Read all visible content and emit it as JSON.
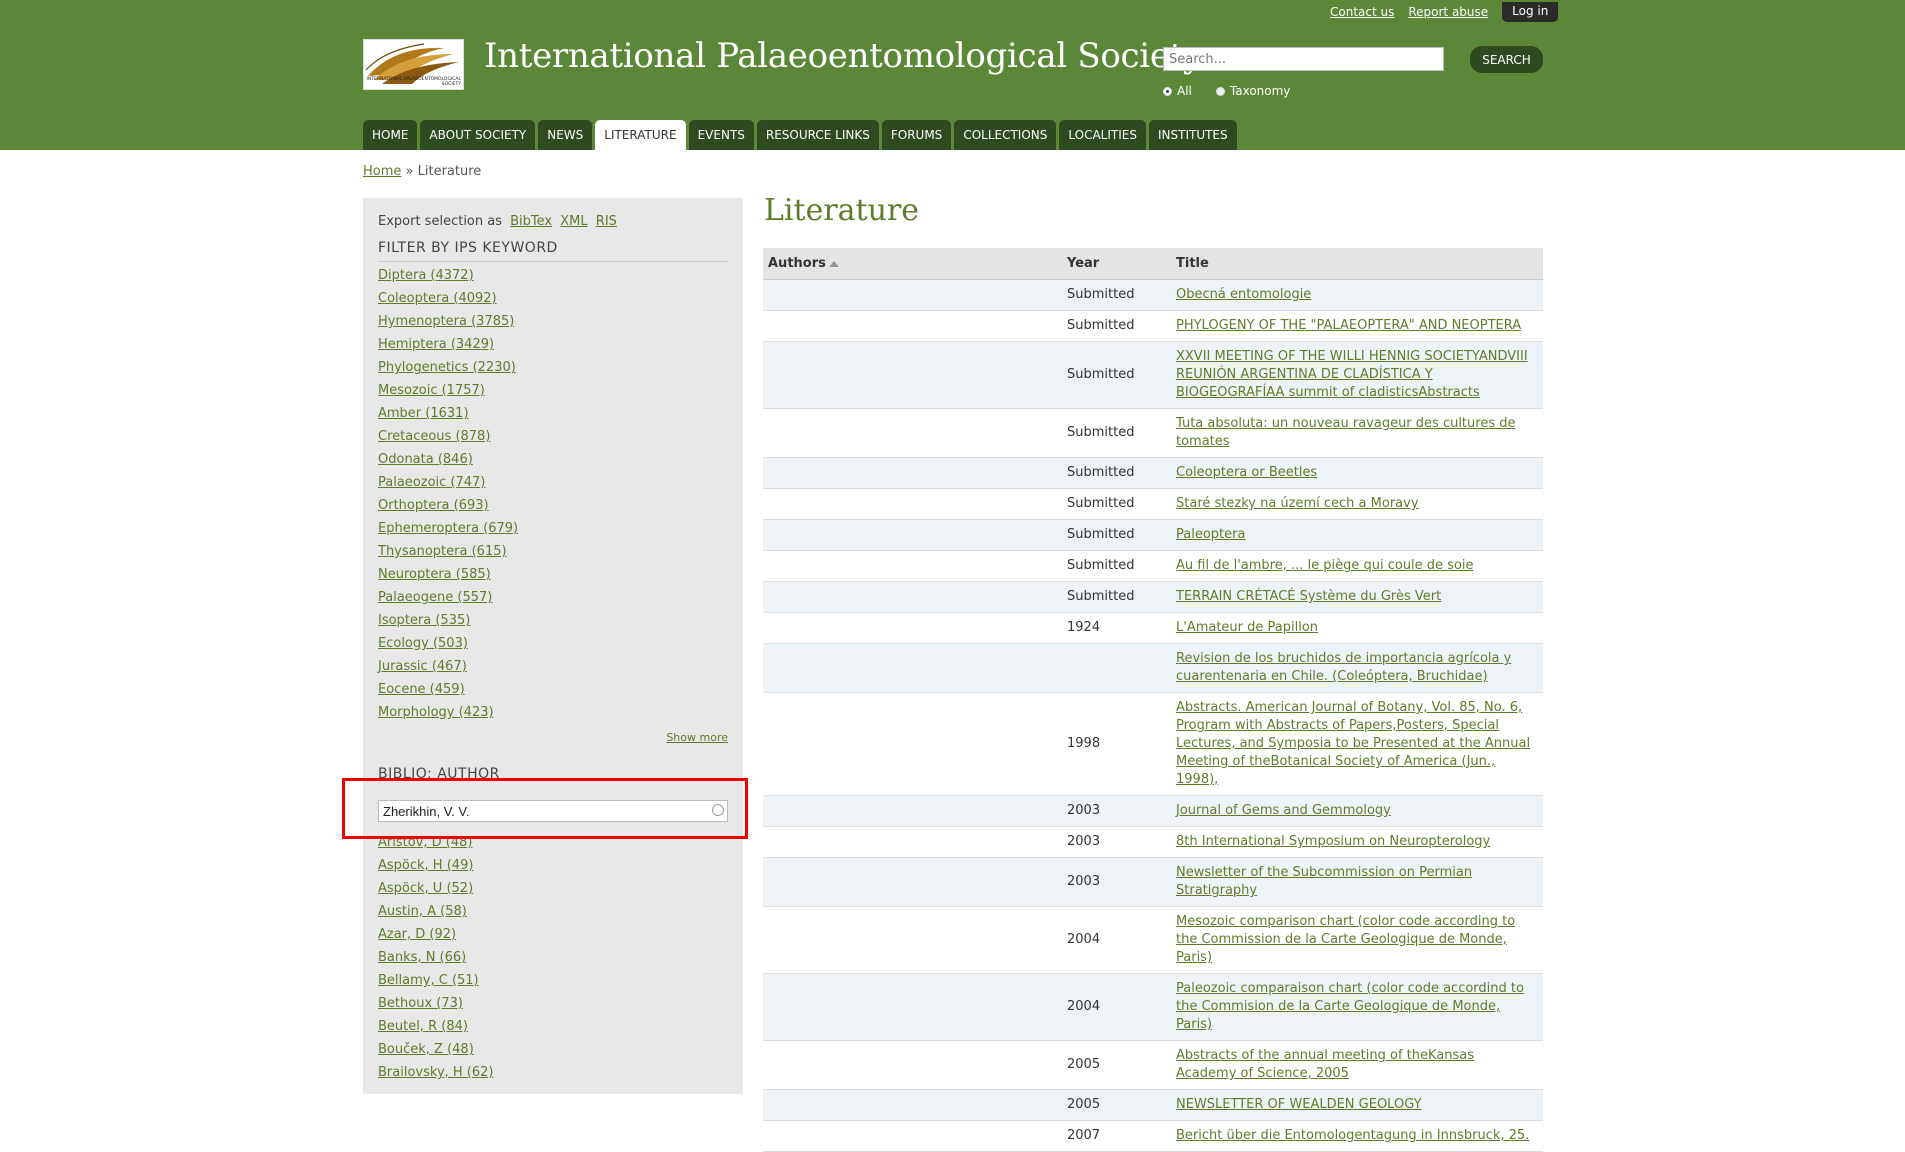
{
  "header": {
    "contact_label": "Contact us",
    "report_label": "Report abuse",
    "login_label": "Log in",
    "site_title": "International Palaeoentomological Society",
    "logo_text": "INTERNATIONAL PALAEOENTOMOLOGICAL SOCIETY",
    "search_placeholder": "Search...",
    "search_button": "Search",
    "radio_all": "All",
    "radio_taxonomy": "Taxonomy",
    "nav": [
      "HOME",
      "ABOUT SOCIETY",
      "NEWS",
      "LITERATURE",
      "EVENTS",
      "RESOURCE LINKS",
      "FORUMS",
      "COLLECTIONS",
      "LOCALITIES",
      "INSTITUTES"
    ],
    "active_tab": "LITERATURE"
  },
  "breadcrumb": {
    "home": "Home",
    "sep": "»",
    "current": "Literature"
  },
  "sidebar": {
    "export_label": "Export selection as",
    "export_formats": [
      "BibTex",
      "XML",
      "RIS"
    ],
    "keyword_title": "FILTER BY IPS KEYWORD",
    "keywords": [
      "Diptera (4372)",
      "Coleoptera (4092)",
      "Hymenoptera (3785)",
      "Hemiptera (3429)",
      "Phylogenetics (2230)",
      "Mesozoic (1757)",
      "Amber (1631)",
      "Cretaceous (878)",
      "Odonata (846)",
      "Palaeozoic (747)",
      "Orthoptera (693)",
      "Ephemeroptera (679)",
      "Thysanoptera (615)",
      "Neuroptera (585)",
      "Palaeogene (557)",
      "Isoptera (535)",
      "Ecology (503)",
      "Jurassic (467)",
      "Eocene (459)",
      "Morphology (423)"
    ],
    "show_more": "Show more",
    "author_title": "BIBLIO: AUTHOR",
    "author_input_value": "Zherikhin, V. V.",
    "authors": [
      "Aristov, D (48)",
      "Aspöck, H (49)",
      "Aspöck, U (52)",
      "Austin, A (58)",
      "Azar, D (92)",
      "Banks, N (66)",
      "Bellamy, C (51)",
      "Bethoux (73)",
      "Beutel, R (84)",
      "Bouček, Z (48)",
      "Brailovsky, H (62)"
    ]
  },
  "main": {
    "title": "Literature",
    "columns": {
      "authors": "Authors",
      "year": "Year",
      "title": "Title"
    },
    "rows": [
      {
        "year": "Submitted",
        "title": "Obecná entomologie"
      },
      {
        "year": "Submitted",
        "title": "PHYLOGENY OF THE \"PALAEOPTERA\" AND NEOPTERA"
      },
      {
        "year": "Submitted",
        "title": "XXVII MEETING OF THE WILLI HENNIG SOCIETYANDVIII REUNIÓN ARGENTINA DE CLADÍSTICA Y BIOGEOGRAFÍAA summit of cladisticsAbstracts"
      },
      {
        "year": "Submitted",
        "title": "Tuta absoluta: un nouveau ravageur des cultures de tomates"
      },
      {
        "year": "Submitted",
        "title": "Coleoptera or Beetles"
      },
      {
        "year": "Submitted",
        "title": "Staré stezky na území cech a Moravy"
      },
      {
        "year": "Submitted",
        "title": "Paleoptera"
      },
      {
        "year": "Submitted",
        "title": "Au fil de l'ambre, ... le piège qui coule de soie"
      },
      {
        "year": "Submitted",
        "title": "TERRAIN CRÉTACÉ Système du Grès Vert"
      },
      {
        "year": "1924",
        "title": "L'Amateur de Papillon"
      },
      {
        "year": "",
        "title": "Revision de los bruchidos de importancia agrícola y cuarentenaria en Chile. (Coleóptera, Bruchidae)"
      },
      {
        "year": "1998",
        "title": "Abstracts. American Journal of Botany, Vol. 85, No. 6, Program with Abstracts of Papers,Posters, Special Lectures, and Symposia to be Presented at the Annual Meeting of theBotanical Society of America (Jun., 1998),"
      },
      {
        "year": "2003",
        "title": "Journal of Gems and Gemmology"
      },
      {
        "year": "2003",
        "title": "8th International Symposium on Neuropterology"
      },
      {
        "year": "2003",
        "title": "Newsletter of the Subcommission on Permian Stratigraphy"
      },
      {
        "year": "2004",
        "title": "Mesozoic comparison chart (color code according to the Commission de la Carte Geologique de Monde, Paris)"
      },
      {
        "year": "2004",
        "title": "Paleozoic comparaison chart (color code accordind to the Commision de la Carte Geologique de Monde, Paris)"
      },
      {
        "year": "2005",
        "title": "Abstracts of the annual meeting of theKansas Academy of Science, 2005"
      },
      {
        "year": "2005",
        "title": "NEWSLETTER OF WEALDEN GEOLOGY"
      },
      {
        "year": "2007",
        "title": "Bericht über die Entomologentagung in Innsbruck, 25."
      }
    ]
  },
  "colors": {
    "header_green": "#5b8838",
    "nav_dark": "#2f4a1f",
    "link_green": "#5e7c2a",
    "highlight_red": "#ee0000"
  }
}
